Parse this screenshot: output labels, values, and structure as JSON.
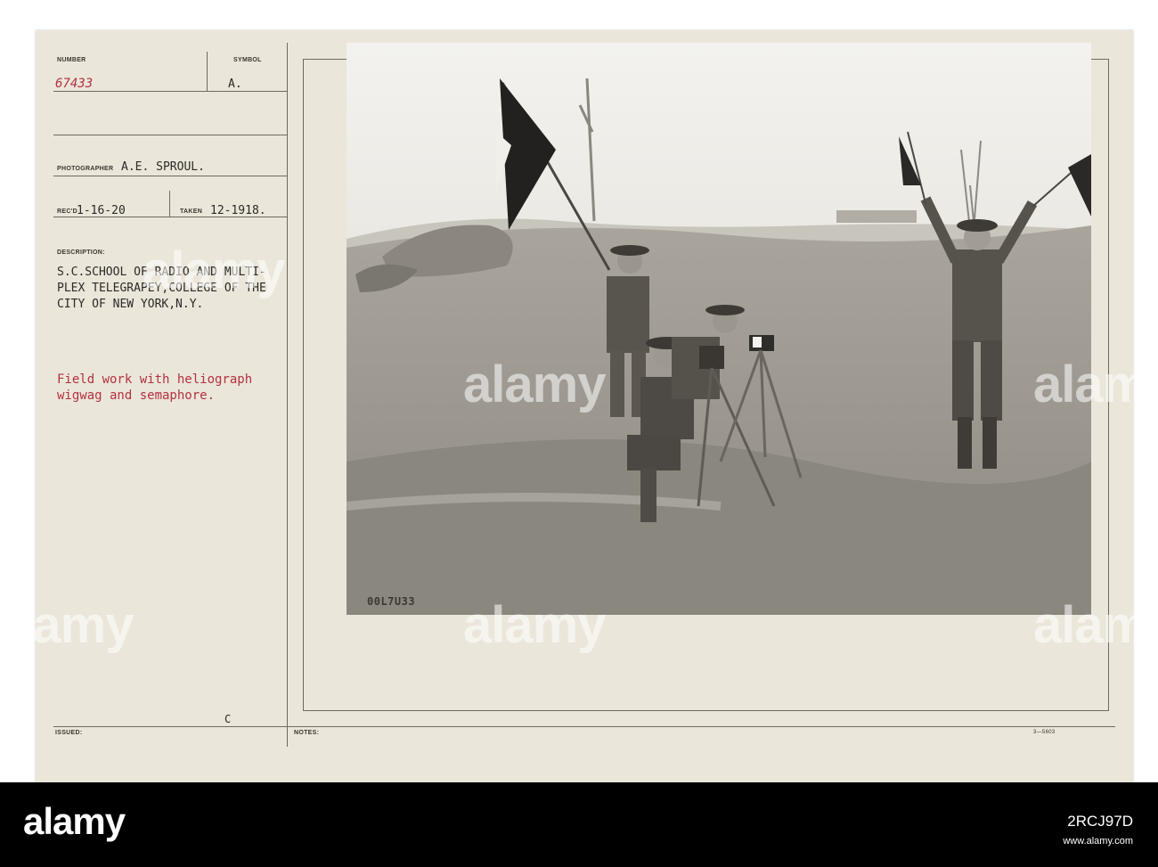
{
  "card": {
    "number_label": "NUMBER",
    "number_value": "67433",
    "symbol_label": "SYMBOL",
    "symbol_value": "A.",
    "photographer_label": "PHOTOGRAPHER",
    "photographer_value": "A.E. SPROUL.",
    "recd_label": "REC'D",
    "recd_value": "1-16-20",
    "taken_label": "TAKEN",
    "taken_value": "12-1918.",
    "description_label": "DESCRIPTION:",
    "description_lines": [
      "S.C.SCHOOL OF RADIO AND MULTI-",
      "PLEX TELEGRAPEY,COLLEGE OF THE",
      "CITY OF NEW YORK,N.Y."
    ],
    "caption_lines": [
      "Field work with heliograph",
      "wigwag and semaphore."
    ],
    "issued_label": "ISSUED:",
    "issued_mark": "C",
    "notes_label": "NOTES:",
    "form_number": "3—5603",
    "negative_number": "00L7U33"
  },
  "watermark_text": "alamy",
  "footer": {
    "logo": "alamy",
    "image_id": "2RCJ97D",
    "url": "www.alamy.com"
  },
  "colors": {
    "card": "#ebe6da",
    "rule": "#6f6a60",
    "red_type": "#b2313f",
    "footer": "#000000"
  }
}
